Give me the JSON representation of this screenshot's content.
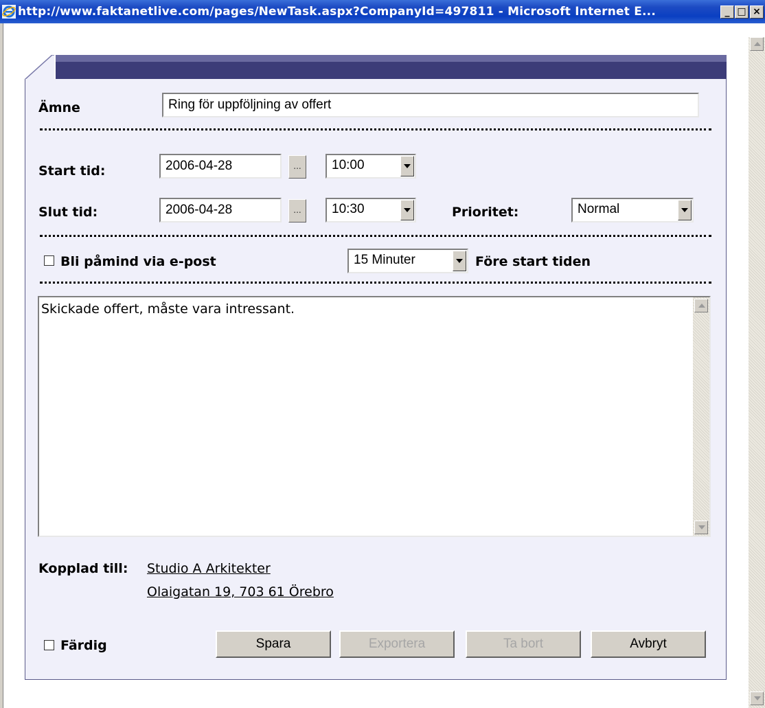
{
  "window": {
    "title": "http://www.faktanetlive.com/pages/NewTask.aspx?CompanyId=497811 - Microsoft Internet E...",
    "minimize_glyph": "_",
    "maximize_glyph": "□",
    "close_glyph": "×",
    "icon": "ie-icon"
  },
  "form": {
    "subject": {
      "label": "Ämne",
      "value": "Ring för uppföljning av offert"
    },
    "start": {
      "label": "Start tid:",
      "date": "2006-04-28",
      "picker": "...",
      "time": "10:00"
    },
    "end": {
      "label": "Slut tid:",
      "date": "2006-04-28",
      "picker": "...",
      "time": "10:30"
    },
    "priority": {
      "label": "Prioritet:",
      "value": "Normal"
    },
    "reminder": {
      "label": "Bli påmind via e-post",
      "checked": false,
      "interval": "15 Minuter",
      "suffix": "Före start tiden"
    },
    "notes": "Skickade offert, måste vara intressant.",
    "linked": {
      "label": "Kopplad till:",
      "company": "Studio A Arkitekter",
      "address": "Olaigatan 19, 703 61 Örebro"
    },
    "done": {
      "label": "Färdig",
      "checked": false
    },
    "buttons": {
      "save": "Spara",
      "export": "Exportera",
      "delete": "Ta bort",
      "cancel": "Avbryt"
    }
  },
  "colors": {
    "titlebar": "#0a3fc2",
    "tab_header": "#3c3c78",
    "panel_bg": "#f0f0fa",
    "button_face": "#d4d0c8",
    "disabled_text": "#a6a6a6"
  }
}
